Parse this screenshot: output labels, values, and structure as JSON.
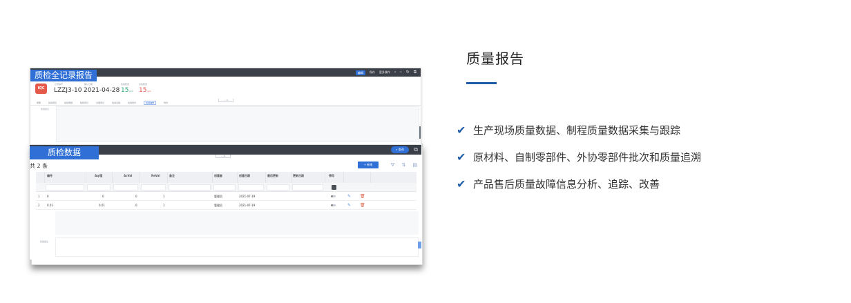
{
  "heading": "质量报告",
  "features": [
    "生产现场质量数据、制程质量数据采集与跟踪",
    "原材料、自制零部件、外协零部件批次和质量追溯",
    "产品售后质量故障信息分析、追踪、改善"
  ],
  "report_window": {
    "title": "质检全记录报告",
    "badge": "IQC",
    "record_no_label": "记录编号",
    "record_no": "LZZJ3-10",
    "date_label": "确认日期",
    "date": "2021-04-28",
    "inspect_qty_label": "检验数量",
    "inspect_qty": "15",
    "inspect_unit": "pcs",
    "pass_qty_label": "合格数量",
    "pass_qty": "15",
    "pass_unit": "pcs",
    "remark_label": "检验备注",
    "toolbar": [
      "编辑",
      "保存",
      "更多操作"
    ],
    "tabs": [
      "概要",
      "检验项目",
      "检验明细",
      "缺陷登记",
      "处理登记",
      "检验过程",
      "检验附件",
      "检验抽样",
      "附件"
    ],
    "active_tab_index": 7
  },
  "data_window": {
    "title": "质检数据",
    "search_label": "查询",
    "count_label": "共 2 条",
    "add_label": "+ 新增",
    "columns": [
      "编号",
      "Aql值",
      "AcVal",
      "ReVal",
      "备注",
      "创建者",
      "创建日期",
      "最后更新",
      "更新日期",
      "停用"
    ],
    "rows": [
      {
        "index": "1",
        "code": "0",
        "aql": "0",
        "acval": "0",
        "reval": "1",
        "creator": "管理员",
        "created": "2021-07-19"
      },
      {
        "index": "2",
        "code": "0.01",
        "aql": "0.01",
        "acval": "0",
        "reval": "1",
        "creator": "管理员",
        "created": "2021-07-19"
      }
    ],
    "bottom_label": "检验备注"
  }
}
